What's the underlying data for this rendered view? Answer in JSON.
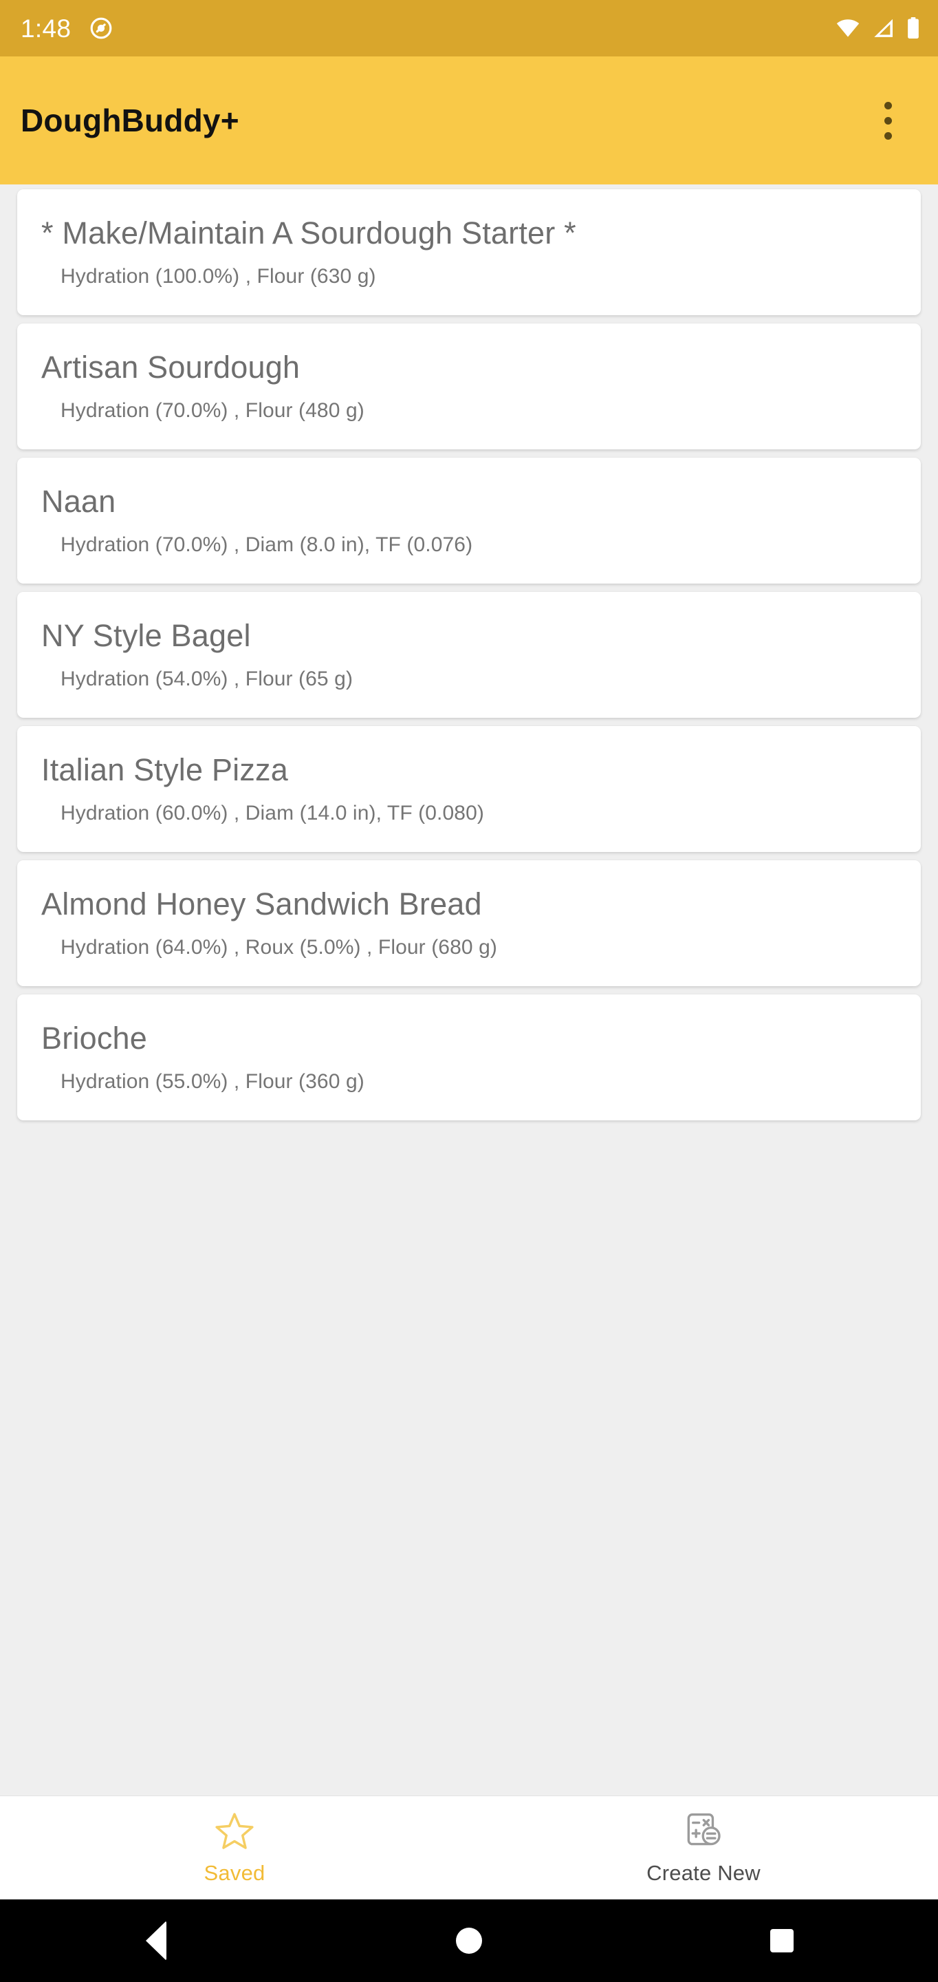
{
  "status_bar": {
    "time": "1:48",
    "icons": [
      "do-not-disturb-icon",
      "wifi-icon",
      "cell-signal-icon",
      "battery-icon"
    ],
    "background": "#d9a62c"
  },
  "app_bar": {
    "title": "DoughBuddy+",
    "overflow_label": "More options",
    "background": "#f9c948"
  },
  "recipes": [
    {
      "title": "* Make/Maintain A Sourdough Starter *",
      "details": "Hydration (100.0%) , Flour (630 g)"
    },
    {
      "title": "Artisan Sourdough",
      "details": "Hydration (70.0%) , Flour (480 g)"
    },
    {
      "title": "Naan",
      "details": "Hydration (70.0%) , Diam (8.0 in), TF (0.076)"
    },
    {
      "title": "NY Style Bagel",
      "details": "Hydration (54.0%) , Flour (65 g)"
    },
    {
      "title": "Italian Style Pizza",
      "details": "Hydration (60.0%) , Diam (14.0 in), TF (0.080)"
    },
    {
      "title": "Almond Honey Sandwich Bread",
      "details": "Hydration (64.0%) , Roux (5.0%) , Flour (680 g)"
    },
    {
      "title": "Brioche",
      "details": "Hydration (55.0%) , Flour (360 g)"
    }
  ],
  "bottom_nav": {
    "items": [
      {
        "label": "Saved",
        "icon": "star-outline-icon",
        "active": true,
        "color": "#f2bb36"
      },
      {
        "label": "Create New",
        "icon": "calculator-icon",
        "active": false,
        "color": "#4d4d4d"
      }
    ]
  },
  "system_nav": {
    "back": "back-triangle-icon",
    "home": "home-circle-icon",
    "recents": "recents-square-icon"
  },
  "colors": {
    "status_bar": "#d9a62c",
    "app_bar": "#f9c948",
    "page_background": "#efefef",
    "card": "#ffffff",
    "title_text": "#6e6e6e",
    "accent": "#f2bb36"
  }
}
